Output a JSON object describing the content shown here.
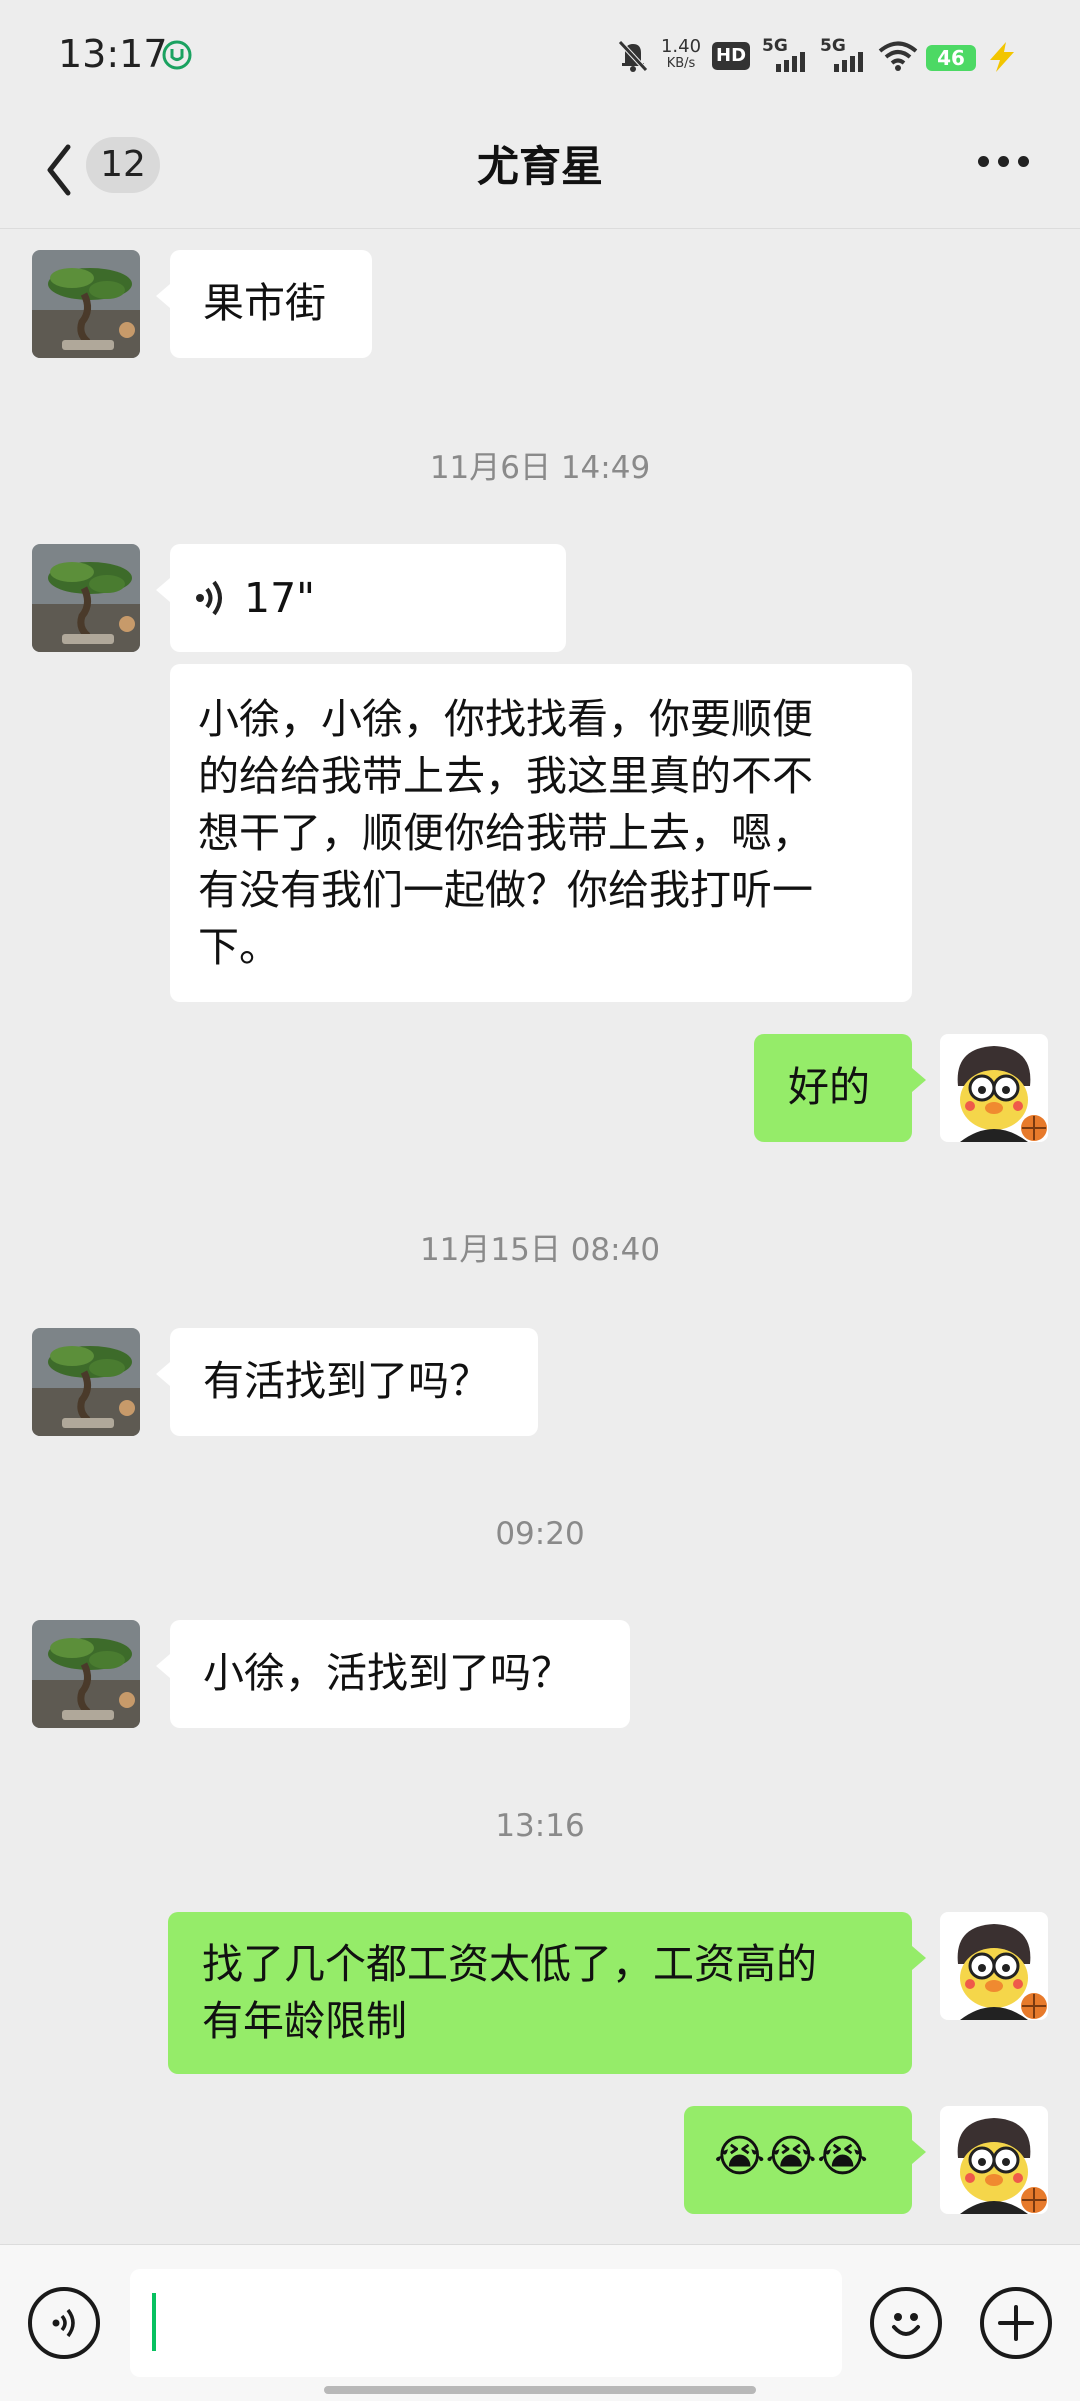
{
  "status_bar": {
    "time": "13:17",
    "net_speed_value": "1.40",
    "net_speed_unit": "KB/s",
    "hd_label": "HD",
    "signal1_label": "5G",
    "signal2_label": "5G",
    "battery": "46",
    "icons": [
      "app-notification-icon",
      "mute-bell-icon",
      "hd-icon",
      "signal-5g-icon",
      "signal-5g-icon",
      "wifi-icon",
      "battery-icon",
      "charging-icon"
    ]
  },
  "header": {
    "back_badge": "12",
    "title": "尤育星"
  },
  "messages": [
    {
      "type": "text",
      "direction": "in",
      "text": "果市街"
    },
    {
      "type": "timestamp",
      "text": "11月6日 14:49"
    },
    {
      "type": "voice",
      "direction": "in",
      "duration": "17\""
    },
    {
      "type": "transcript",
      "direction": "in",
      "lines": [
        "小徐，小徐，你找找看，你要顺便",
        "的给给我带上去，我这里真的不不",
        "想干了，顺便你给我带上去，嗯，",
        "有没有我们一起做？你给我打听一",
        "下。"
      ]
    },
    {
      "type": "text",
      "direction": "out",
      "text": "好的"
    },
    {
      "type": "timestamp",
      "text": "11月15日 08:40"
    },
    {
      "type": "text",
      "direction": "in",
      "text": "有活找到了吗？"
    },
    {
      "type": "timestamp",
      "text": "09:20"
    },
    {
      "type": "text",
      "direction": "in",
      "text": "小徐，活找到了吗？"
    },
    {
      "type": "timestamp",
      "text": "13:16"
    },
    {
      "type": "text",
      "direction": "out",
      "lines": [
        "找了几个都工资太低了，工资高的",
        "有年龄限制"
      ]
    },
    {
      "type": "emoji",
      "direction": "out",
      "text": "😭😭😭"
    }
  ],
  "input_bar": {
    "voice_button_icon": "voice-icon",
    "emoji_button_icon": "smiley-icon",
    "plus_button_icon": "plus-icon"
  },
  "colors": {
    "background": "#ededed",
    "outgoing_bubble": "#95ec69",
    "incoming_bubble": "#ffffff",
    "accent": "#07c160"
  }
}
